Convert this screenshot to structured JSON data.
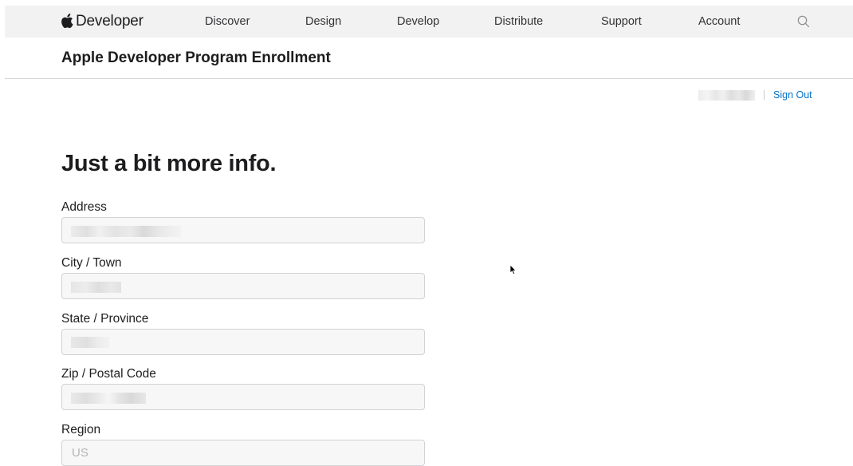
{
  "header": {
    "brand_label": "Developer",
    "nav_items": [
      {
        "label": "Discover"
      },
      {
        "label": "Design"
      },
      {
        "label": "Develop"
      },
      {
        "label": "Distribute"
      },
      {
        "label": "Support"
      },
      {
        "label": "Account"
      }
    ],
    "search_icon": "search-icon"
  },
  "subnav": {
    "title": "Apple Developer Program Enrollment"
  },
  "account": {
    "user_name": "",
    "sign_out_label": "Sign Out"
  },
  "form": {
    "heading": "Just a bit more info.",
    "fields": [
      {
        "label": "Address",
        "value": ""
      },
      {
        "label": "City / Town",
        "value": ""
      },
      {
        "label": "State / Province",
        "value": ""
      },
      {
        "label": "Zip / Postal Code",
        "value": ""
      },
      {
        "label": "Region",
        "value": "US"
      }
    ]
  },
  "colors": {
    "nav_background": "#f2f2f2",
    "link": "#0070c9",
    "input_background": "#f7f7f7",
    "input_border": "#d2d2d7",
    "text": "#1d1d1f"
  }
}
